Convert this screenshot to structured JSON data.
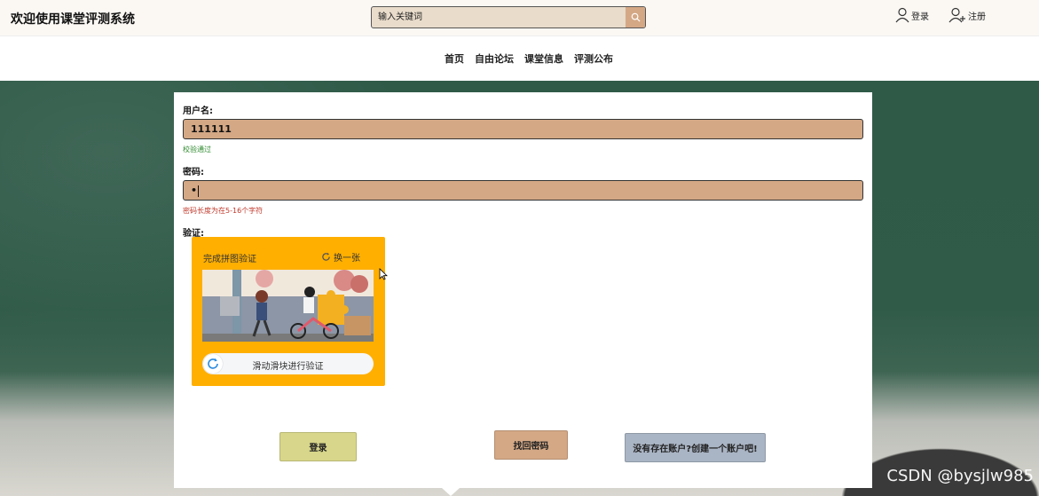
{
  "header": {
    "site_title": "欢迎使用课堂评测系统",
    "search_placeholder": "输入关键词",
    "login_label": "登录",
    "register_label": "注册"
  },
  "nav": {
    "items": [
      "首页",
      "自由论坛",
      "课堂信息",
      "评测公布"
    ]
  },
  "form": {
    "username_label": "用户名:",
    "username_value": "111111",
    "username_hint": "校验通过",
    "password_label": "密码:",
    "password_value": "•",
    "password_hint": "密码长度为在5-16个字符",
    "captcha_label": "验证:"
  },
  "captcha": {
    "title": "完成拼图验证",
    "refresh_label": "换一张",
    "slider_text": "滑动滑块进行验证"
  },
  "buttons": {
    "login": "登录",
    "forgot_password": "找回密码",
    "create_account": "没有存在账户?创建一个账户吧!"
  },
  "watermark": "CSDN @bysjlw985",
  "colors": {
    "field_bg": "#d4a885",
    "captcha_bg": "#ffaf00",
    "login_btn": "#d7d68a",
    "register_btn": "#a9b4c4",
    "valid_hint": "#2f8a2f",
    "error_hint": "#c0392b"
  }
}
